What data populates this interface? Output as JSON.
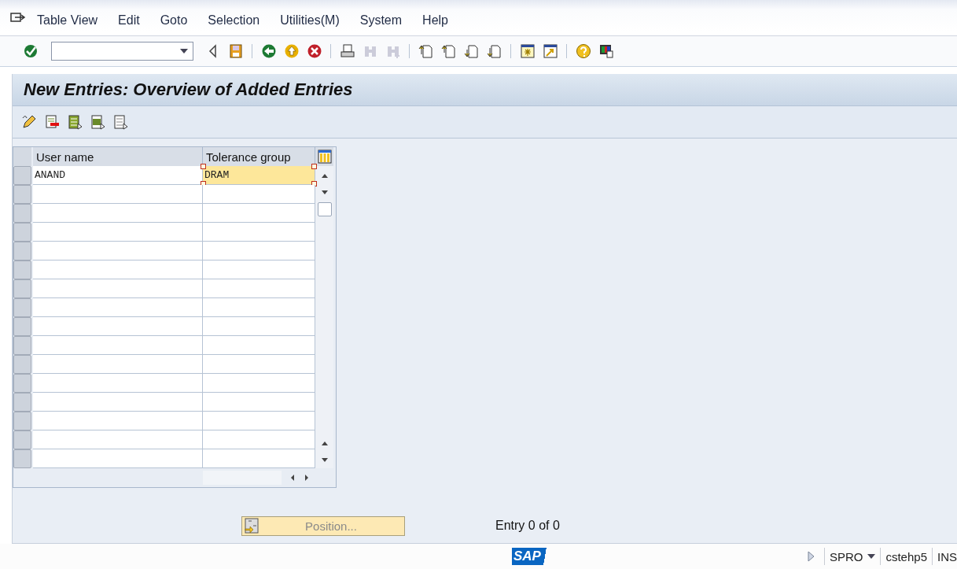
{
  "menu_bar": {
    "items": [
      "Table View",
      "Edit",
      "Goto",
      "Selection",
      "Utilities(M)",
      "System",
      "Help"
    ]
  },
  "toolbar": {
    "items": [
      {
        "kind": "enter",
        "disabled": false
      },
      {
        "kind": "command-field"
      },
      {
        "kind": "collapse",
        "disabled": false
      },
      {
        "kind": "save",
        "disabled": false
      },
      {
        "kind": "separator"
      },
      {
        "kind": "back",
        "disabled": false
      },
      {
        "kind": "exit",
        "disabled": false
      },
      {
        "kind": "cancel",
        "disabled": false
      },
      {
        "kind": "separator"
      },
      {
        "kind": "print",
        "disabled": false
      },
      {
        "kind": "find",
        "disabled": true
      },
      {
        "kind": "find-next",
        "disabled": true
      },
      {
        "kind": "separator"
      },
      {
        "kind": "first-page",
        "disabled": false
      },
      {
        "kind": "previous-page",
        "disabled": false
      },
      {
        "kind": "next-page",
        "disabled": false
      },
      {
        "kind": "last-page",
        "disabled": false
      },
      {
        "kind": "separator"
      },
      {
        "kind": "new-session",
        "disabled": false
      },
      {
        "kind": "shortcut",
        "disabled": false
      },
      {
        "kind": "separator"
      },
      {
        "kind": "help",
        "disabled": false
      },
      {
        "kind": "layout",
        "disabled": false
      }
    ]
  },
  "title": "New Entries: Overview of Added Entries",
  "app_toolbar": {
    "items": [
      {
        "kind": "change"
      },
      {
        "kind": "delete"
      },
      {
        "kind": "select-all"
      },
      {
        "kind": "select-block"
      },
      {
        "kind": "deselect-all"
      }
    ]
  },
  "table": {
    "columns": [
      "User name",
      "Tolerance group"
    ],
    "rows": [
      {
        "cells": [
          {
            "text": "ANAND",
            "focused": false
          },
          {
            "text": "DRAM",
            "focused": true
          }
        ],
        "selected": false
      }
    ]
  },
  "position_button": "Position...",
  "entry_count": "Entry 0 of 0",
  "status_bar": {
    "logo": "SAP",
    "transaction": "SPRO",
    "server": "cstehp5",
    "mode": "INS"
  }
}
